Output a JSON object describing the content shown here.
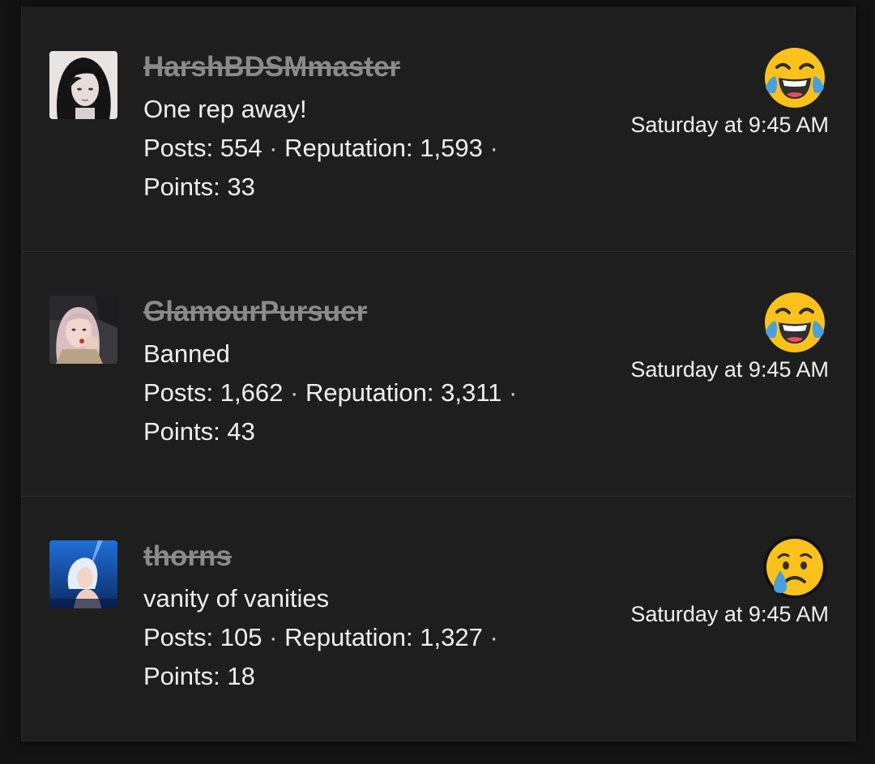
{
  "reactions": [
    {
      "username": "HarshBDSMmaster",
      "user_title": "One rep away!",
      "posts_label": "Posts:",
      "posts": "554",
      "reputation_label": "Reputation:",
      "reputation": "1,593",
      "points_label": "Points:",
      "points": "33",
      "timestamp": "Saturday at 9:45 AM",
      "reaction_icon": "laughing-tears-emoji"
    },
    {
      "username": "GlamourPursuer",
      "user_title": "Banned",
      "posts_label": "Posts:",
      "posts": "1,662",
      "reputation_label": "Reputation:",
      "reputation": "3,311",
      "points_label": "Points:",
      "points": "43",
      "timestamp": "Saturday at 9:45 AM",
      "reaction_icon": "laughing-tears-emoji"
    },
    {
      "username": "thorns",
      "user_title": "vanity of vanities",
      "posts_label": "Posts:",
      "posts": "105",
      "reputation_label": "Reputation:",
      "reputation": "1,327",
      "points_label": "Points:",
      "points": "18",
      "timestamp": "Saturday at 9:45 AM",
      "reaction_icon": "sad-tear-emoji"
    }
  ],
  "colors": {
    "panel_bg": "#1e1e1e",
    "page_bg": "#131313",
    "text": "#f0f0f0",
    "username_struck": "#8a8a8a",
    "emoji_yellow": "#fcc21b",
    "tear_blue": "#4a9fe0"
  }
}
